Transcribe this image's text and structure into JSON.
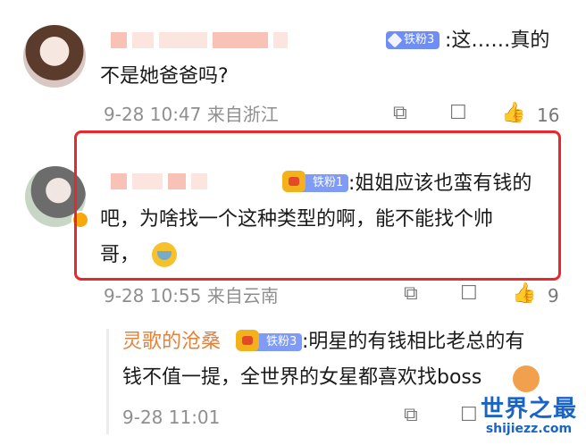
{
  "comments": [
    {
      "fan_badge": "铁粉3",
      "text_line1": ":这……真的",
      "text_line2": "不是她爸爸吗?",
      "time": "9-28 10:47",
      "location": "来自浙江",
      "likes": "16"
    },
    {
      "fan_badge": "铁粉1",
      "text_line1": ":姐姐应该也蛮有钱的",
      "text_line2": "吧，为啥找一个这种类型的啊，能不能找个帅",
      "text_line3": "哥，",
      "time": "9-28 10:55",
      "location": "来自云南",
      "likes": "9"
    }
  ],
  "reply": {
    "author": "灵歌的沧桑",
    "fan_badge": "铁粉3",
    "text_line1": ":明星的有钱相比老总的有",
    "text_line2": "钱不值一提，全世界的女星都喜欢找boss",
    "time": "9-28 11:01"
  },
  "watermark": {
    "main": "世界之最",
    "sub": "shijiezz.com"
  },
  "icons": {
    "share": "share-icon",
    "comment": "comment-icon",
    "like": "thumbs-up-icon"
  }
}
